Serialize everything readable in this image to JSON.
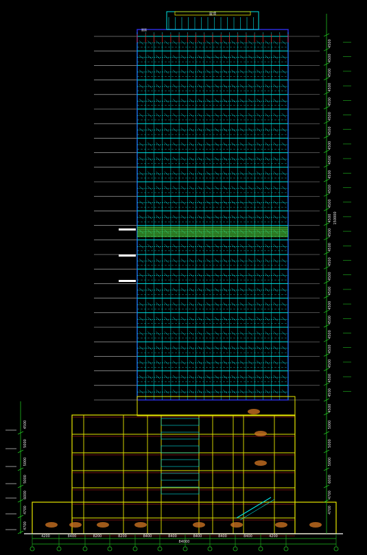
{
  "drawing": {
    "background": "#000000",
    "colors": {
      "tower_grid": "#00e5e5",
      "tower_outline": "#2a2ad8",
      "podium": "#e8e800",
      "floor_marker": "#e02020",
      "dimension": "#20c020",
      "level_line": "#c8c8c8",
      "label": "#e8e8e8",
      "text_white": "#ffffff",
      "hatch": "#c87020",
      "green_band": "#30d030"
    },
    "tower_levels": [
      "4500",
      "4500",
      "4500",
      "4500",
      "4500",
      "4500",
      "4500",
      "4500",
      "4500",
      "4500",
      "4500",
      "4500",
      "4500",
      "4500",
      "4500",
      "4500",
      "4500",
      "4500",
      "4500",
      "4500",
      "4500",
      "4500",
      "4500",
      "4500",
      "4500"
    ],
    "podium_levels": [
      "4500",
      "5000",
      "5000",
      "5000",
      "6000",
      "4700",
      "4700"
    ],
    "left_dims": [
      "4700",
      "4700",
      "6000",
      "5000",
      "5000",
      "5000",
      "4500"
    ],
    "total_height": "150000",
    "bottom_axis": [
      "1",
      "2",
      "3",
      "4",
      "5",
      "6",
      "7",
      "8",
      "9",
      "10",
      "11",
      "12"
    ],
    "bottom_dims": [
      "4200",
      "8400",
      "8200",
      "8200",
      "8400",
      "8400",
      "8400",
      "8400",
      "8400",
      "4200"
    ],
    "bottom_total": "84000",
    "crown_label": "屋顶",
    "roof_label": "屋面"
  }
}
